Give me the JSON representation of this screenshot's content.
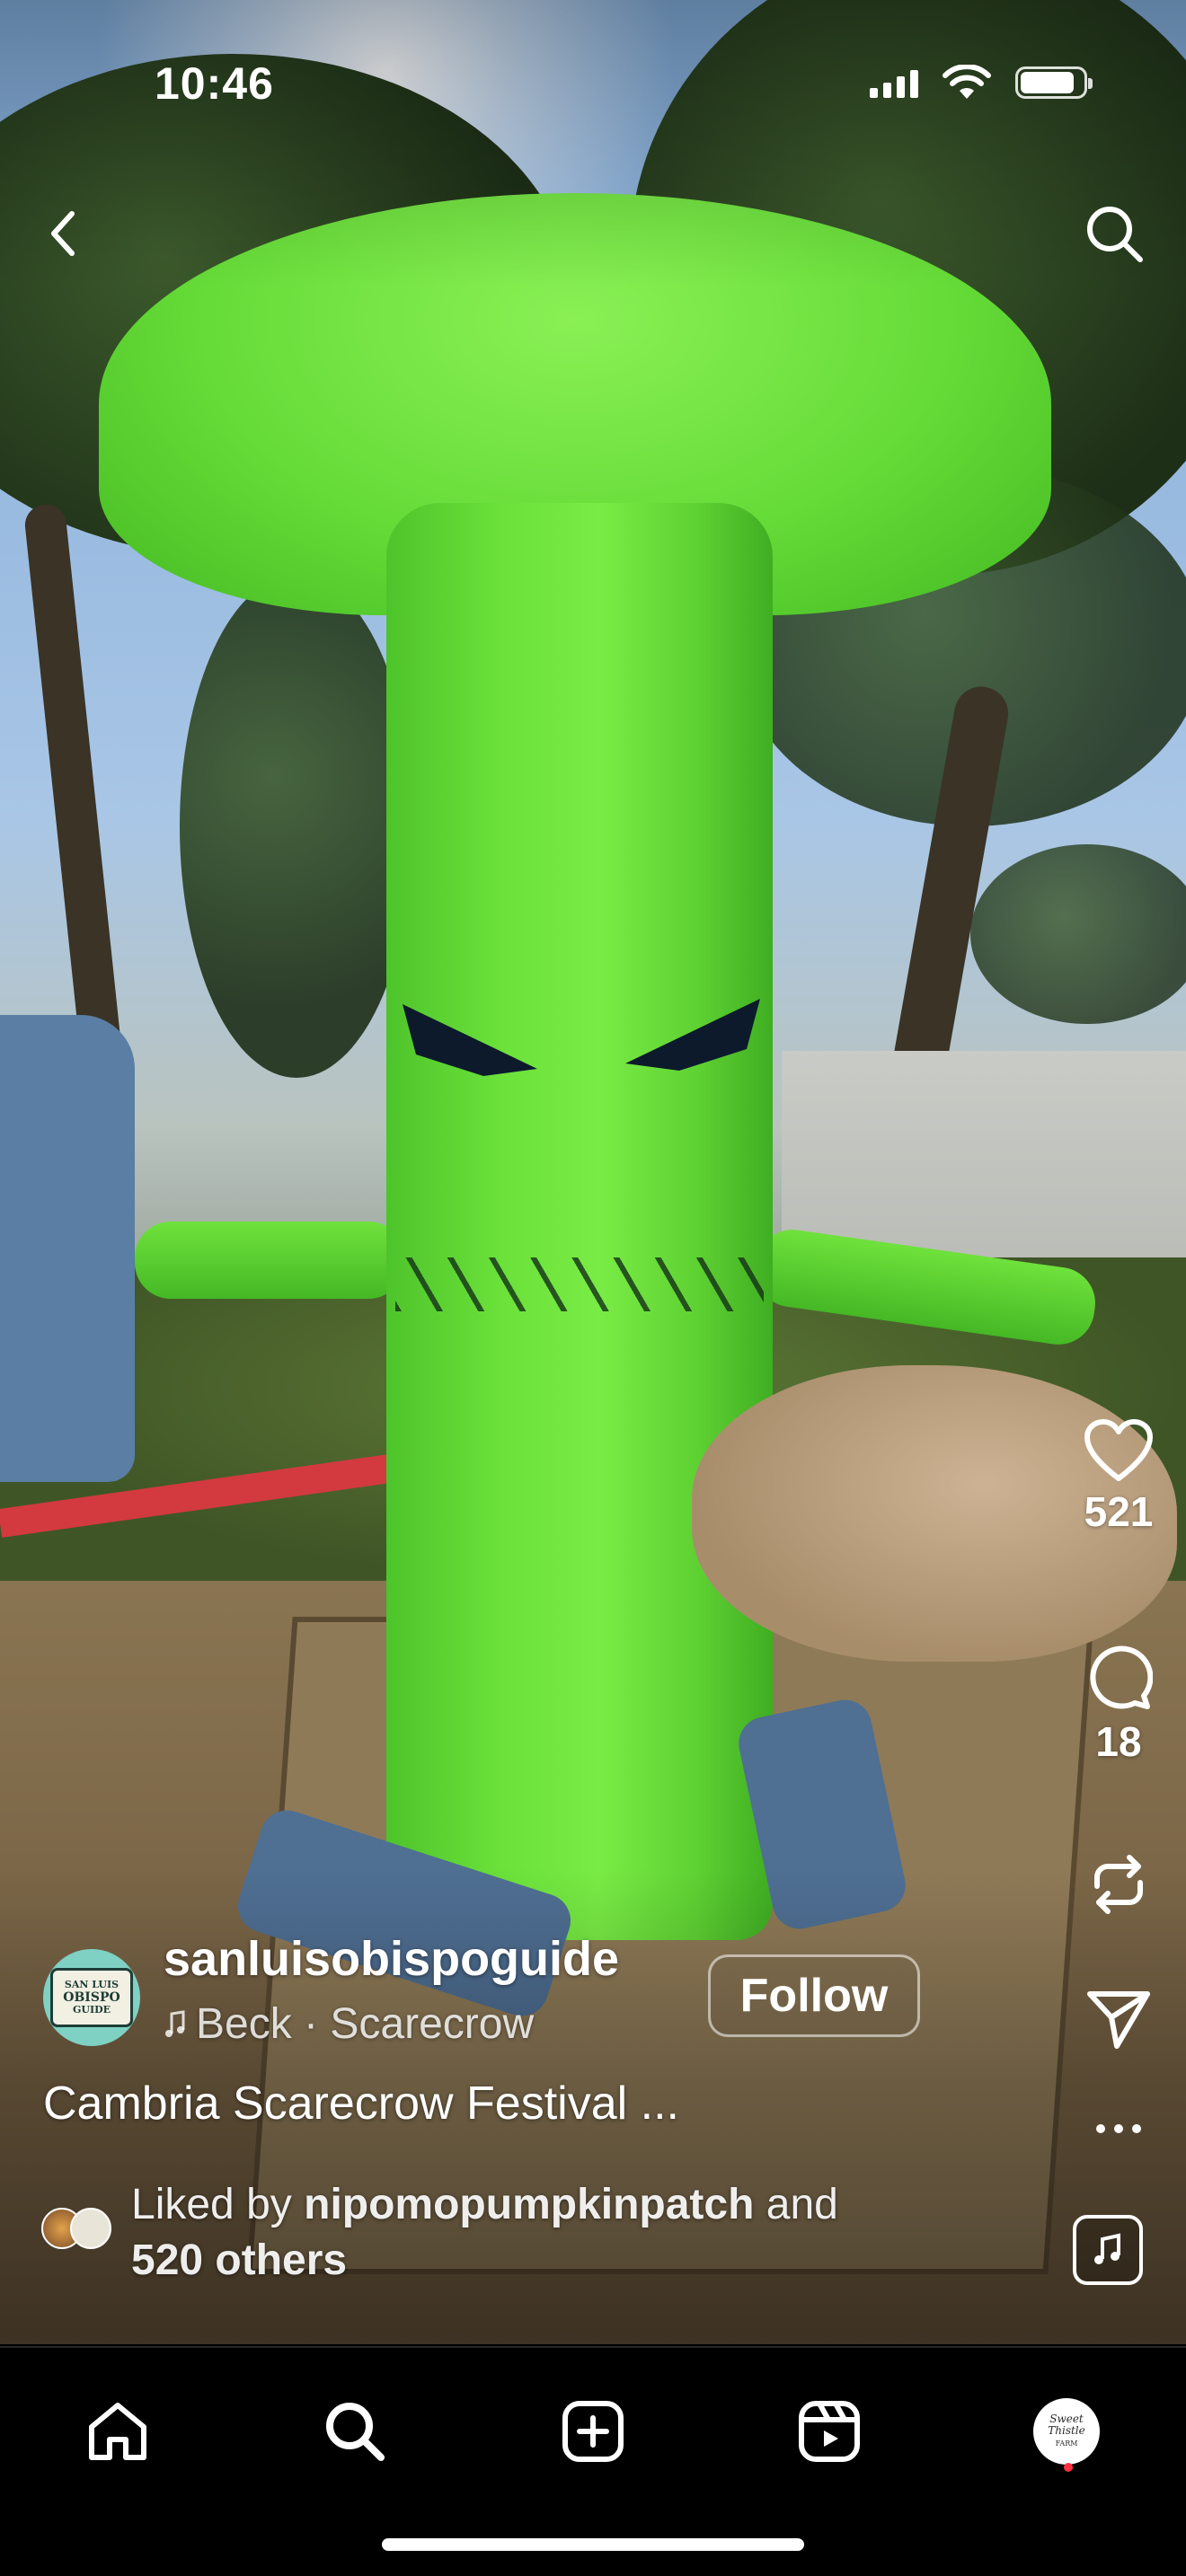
{
  "status_bar": {
    "time": "10:46",
    "icons": [
      "cellular-signal-icon",
      "wifi-icon",
      "battery-icon"
    ]
  },
  "top_nav": {
    "back_icon": "chevron-left-icon",
    "search_icon": "search-icon"
  },
  "actions": {
    "like_icon": "heart-icon",
    "like_count": "521",
    "comment_icon": "comment-icon",
    "comment_count": "18",
    "repost_icon": "repost-icon",
    "share_icon": "send-icon",
    "more_icon": "more-horizontal-icon",
    "audio_icon": "music-note-icon"
  },
  "post": {
    "username": "sanluisobispoguide",
    "avatar_text_top": "SAN LUIS",
    "avatar_text_mid": "OBISPO",
    "avatar_text_bottom": "GUIDE",
    "audio_icon": "music-note-icon",
    "audio_label": "Beck · Scarecrow",
    "follow_label": "Follow",
    "caption": "Cambria Scarecrow Festival ...",
    "liked_by_prefix": "Liked by ",
    "liked_by_user": "nipomopumpkinpatch",
    "liked_by_middle": " and",
    "liked_by_others": "520 others"
  },
  "tab_bar": {
    "tabs": [
      "home-icon",
      "search-icon",
      "create-icon",
      "reels-icon",
      "profile-avatar"
    ],
    "profile_text_1": "Sweet",
    "profile_text_2": "Thistle",
    "profile_text_3": "FARM"
  },
  "colors": {
    "tab_bar_bg": "#000000",
    "notification_dot": "#ff3040",
    "text": "#ffffff"
  }
}
